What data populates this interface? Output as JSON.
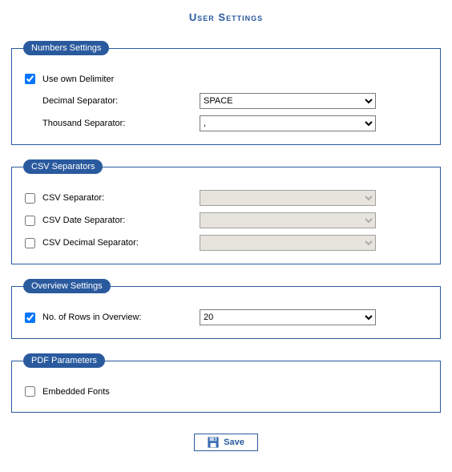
{
  "title": "User Settings",
  "sections": {
    "numbers": {
      "legend": "Numbers Settings",
      "use_own_delimiter": {
        "label": "Use own Delimiter",
        "checked": true
      },
      "decimal_separator": {
        "label": "Decimal Separator:",
        "value": "SPACE"
      },
      "thousand_separator": {
        "label": "Thousand Separator:",
        "value": ","
      }
    },
    "csv": {
      "legend": "CSV Separators",
      "csv_separator": {
        "label": "CSV Separator:",
        "checked": false,
        "value": ""
      },
      "csv_date_separator": {
        "label": "CSV Date Separator:",
        "checked": false,
        "value": ""
      },
      "csv_decimal_separator": {
        "label": "CSV Decimal Separator:",
        "checked": false,
        "value": ""
      }
    },
    "overview": {
      "legend": "Overview Settings",
      "rows": {
        "label": "No. of Rows in Overview:",
        "checked": true,
        "value": "20"
      }
    },
    "pdf": {
      "legend": "PDF Parameters",
      "embedded_fonts": {
        "label": "Embedded Fonts",
        "checked": false
      }
    }
  },
  "buttons": {
    "save": "Save"
  }
}
